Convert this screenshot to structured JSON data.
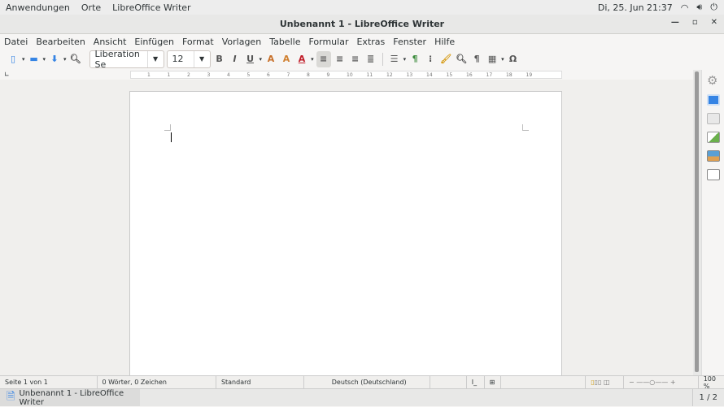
{
  "topbar": {
    "applications": "Anwendungen",
    "places": "Orte",
    "app": "LibreOffice Writer",
    "datetime": "Di, 25. Jun  21:37"
  },
  "window": {
    "title": "Unbenannt 1 - LibreOffice Writer"
  },
  "menu": [
    "Datei",
    "Bearbeiten",
    "Ansicht",
    "Einfügen",
    "Format",
    "Vorlagen",
    "Tabelle",
    "Formular",
    "Extras",
    "Fenster",
    "Hilfe"
  ],
  "toolbar": {
    "font_name": "Liberation Se",
    "font_size": "12",
    "bold": "B",
    "italic": "I",
    "underline": "U",
    "pilcrow": "¶",
    "omega": "Ω"
  },
  "ruler": {
    "ticks": [
      "1",
      "1",
      "2",
      "3",
      "4",
      "5",
      "6",
      "7",
      "8",
      "9",
      "10",
      "11",
      "12",
      "13",
      "14",
      "15",
      "16",
      "17",
      "18",
      "19"
    ]
  },
  "status": {
    "page": "Seite 1 von 1",
    "words": "0 Wörter, 0 Zeichen",
    "style": "Standard",
    "language": "Deutsch (Deutschland)",
    "zoom": "100 %"
  },
  "taskbar": {
    "window": "Unbenannt 1 - LibreOffice Writer",
    "workspace": "1 / 2"
  },
  "colors": {
    "accent": "#3584e4"
  }
}
